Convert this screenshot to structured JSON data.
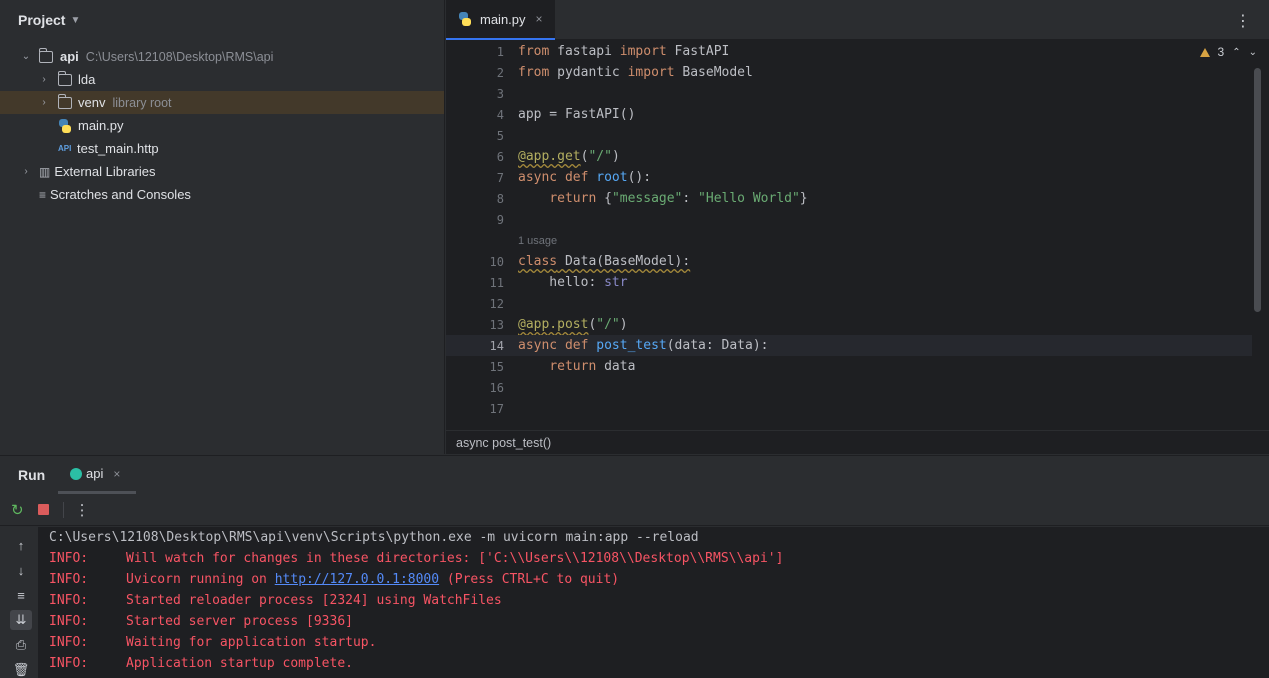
{
  "project_panel": {
    "title": "Project",
    "tree": [
      {
        "name": "api",
        "detail": "C:\\Users\\12108\\Desktop\\RMS\\api",
        "icon": "folder-icon",
        "expanded": true
      },
      {
        "name": "lda",
        "icon": "folder-icon",
        "expanded": false
      },
      {
        "name": "venv",
        "detail": "library root",
        "icon": "folder-icon",
        "expanded": false,
        "selected": true
      },
      {
        "name": "main.py",
        "icon": "python-file-icon"
      },
      {
        "name": "test_main.http",
        "icon": "http-file-icon",
        "icon_text": "API"
      },
      {
        "name": "External Libraries",
        "icon": "libraries-icon",
        "expanded": false
      },
      {
        "name": "Scratches and Consoles",
        "icon": "scratches-icon"
      }
    ]
  },
  "editor": {
    "tab": {
      "label": "main.py",
      "close": "×"
    },
    "inspection": {
      "count": "3"
    },
    "usage_hint": "1 usage",
    "current_line": 14,
    "lines": [
      {
        "n": "1"
      },
      {
        "n": "2"
      },
      {
        "n": "3"
      },
      {
        "n": "4"
      },
      {
        "n": "5"
      },
      {
        "n": "6"
      },
      {
        "n": "7"
      },
      {
        "n": "8"
      },
      {
        "n": "9"
      },
      {
        "n": "10"
      },
      {
        "n": "11"
      },
      {
        "n": "12"
      },
      {
        "n": "13"
      },
      {
        "n": "14"
      },
      {
        "n": "15"
      },
      {
        "n": "16"
      },
      {
        "n": "17"
      }
    ],
    "code": {
      "l1": [
        "from",
        " fastapi ",
        "import",
        " FastAPI"
      ],
      "l2": [
        "from",
        " pydantic ",
        "import",
        " BaseModel"
      ],
      "l4": "app = FastAPI()",
      "l6": [
        "@app.get",
        "(",
        "\"/\"",
        ")"
      ],
      "l7": [
        "async def ",
        "root",
        "():"
      ],
      "l8": [
        "    ",
        "return",
        " {",
        "\"message\"",
        ": ",
        "\"Hello World\"",
        "}"
      ],
      "l10": [
        "class",
        " Data(BaseModel):"
      ],
      "l11": [
        "    hello: ",
        "str"
      ],
      "l13": [
        "@app.post",
        "(",
        "\"/\"",
        ")"
      ],
      "l14": [
        "async def ",
        "post_test",
        "(data: Data):"
      ],
      "l15": [
        "    ",
        "return",
        " data"
      ]
    },
    "breadcrumb": "async post_test()"
  },
  "run_panel": {
    "title": "Run",
    "tab_label": "api",
    "tab_close": "×",
    "console": {
      "command": "C:\\Users\\12108\\Desktop\\RMS\\api\\venv\\Scripts\\python.exe -m uvicorn main:app --reload",
      "lines": [
        {
          "level": "INFO:",
          "text": "Will watch for changes in these directories: ['C:\\\\Users\\\\12108\\\\Desktop\\\\RMS\\\\api']"
        },
        {
          "level": "INFO:",
          "text_before": "Uvicorn running on ",
          "link": "http://127.0.0.1:8000",
          "text_after": " (Press CTRL+C to quit)"
        },
        {
          "level": "INFO:",
          "text": "Started reloader process [2324] using WatchFiles"
        },
        {
          "level": "INFO:",
          "text": "Started server process [9336]"
        },
        {
          "level": "INFO:",
          "text": "Waiting for application startup."
        },
        {
          "level": "INFO:",
          "text": "Application startup complete."
        }
      ]
    }
  },
  "colors": {
    "background": "#2b2d30",
    "editor_bg": "#1e1f22",
    "keyword": "#cf8e6d",
    "function": "#56a8f5",
    "string": "#6aab73",
    "decorator": "#b3ae60",
    "error_text": "#f75464",
    "link": "#548af7",
    "selected_row": "#43392a"
  }
}
